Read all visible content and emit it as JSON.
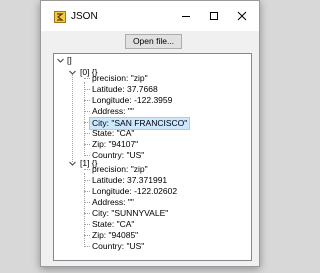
{
  "window": {
    "title": "JSON",
    "open_button_label": "Open file..."
  },
  "tree": {
    "root_label": "[]",
    "groups": [
      {
        "label": "[0] {}",
        "items": [
          "precision: \"zip\"",
          "Latitude: 37.7668",
          "Longitude: -122.3959",
          "Address: \"\"",
          "City: \"SAN FRANCISCO\"",
          "State: \"CA\"",
          "Zip: \"94107\"",
          "Country: \"US\""
        ]
      },
      {
        "label": "[1] {}",
        "items": [
          "precision: \"zip\"",
          "Latitude: 37.371991",
          "Longitude: -122.02602",
          "Address: \"\"",
          "City: \"SUNNYVALE\"",
          "State: \"CA\"",
          "Zip: \"94085\"",
          "Country: \"US\""
        ]
      }
    ],
    "selected_item": "City: \"SAN FRANCISCO\""
  }
}
